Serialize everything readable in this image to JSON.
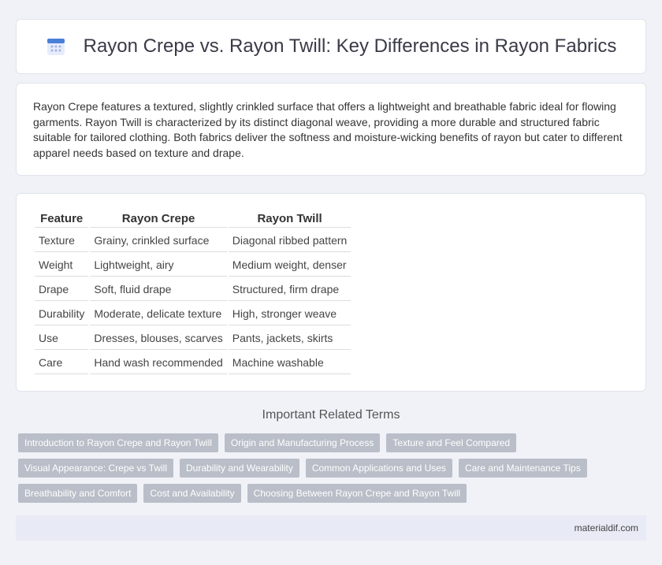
{
  "header": {
    "title": "Rayon Crepe vs. Rayon Twill: Key Differences in Rayon Fabrics",
    "icon": "calendar-icon"
  },
  "intro": {
    "text": "Rayon Crepe features a textured, slightly crinkled surface that offers a lightweight and breathable fabric ideal for flowing garments. Rayon Twill is characterized by its distinct diagonal weave, providing a more durable and structured fabric suitable for tailored clothing. Both fabrics deliver the softness and moisture-wicking benefits of rayon but cater to different apparel needs based on texture and drape."
  },
  "table": {
    "headers": [
      "Feature",
      "Rayon Crepe",
      "Rayon Twill"
    ],
    "rows": [
      [
        "Texture",
        "Grainy, crinkled surface",
        "Diagonal ribbed pattern"
      ],
      [
        "Weight",
        "Lightweight, airy",
        "Medium weight, denser"
      ],
      [
        "Drape",
        "Soft, fluid drape",
        "Structured, firm drape"
      ],
      [
        "Durability",
        "Moderate, delicate texture",
        "High, stronger weave"
      ],
      [
        "Use",
        "Dresses, blouses, scarves",
        "Pants, jackets, skirts"
      ],
      [
        "Care",
        "Hand wash recommended",
        "Machine washable"
      ]
    ]
  },
  "related": {
    "title": "Important Related Terms",
    "tags": [
      "Introduction to Rayon Crepe and Rayon Twill",
      "Origin and Manufacturing Process",
      "Texture and Feel Compared",
      "Visual Appearance: Crepe vs Twill",
      "Durability and Wearability",
      "Common Applications and Uses",
      "Care and Maintenance Tips",
      "Breathability and Comfort",
      "Cost and Availability",
      "Choosing Between Rayon Crepe and Rayon Twill"
    ]
  },
  "footer": {
    "site": "materialdif.com"
  },
  "colors": {
    "tag_bg": "#b9bec8",
    "page_bg": "#f0f2f8",
    "footer_bg": "#e8ebf5",
    "icon_accent": "#4a7fd8"
  }
}
